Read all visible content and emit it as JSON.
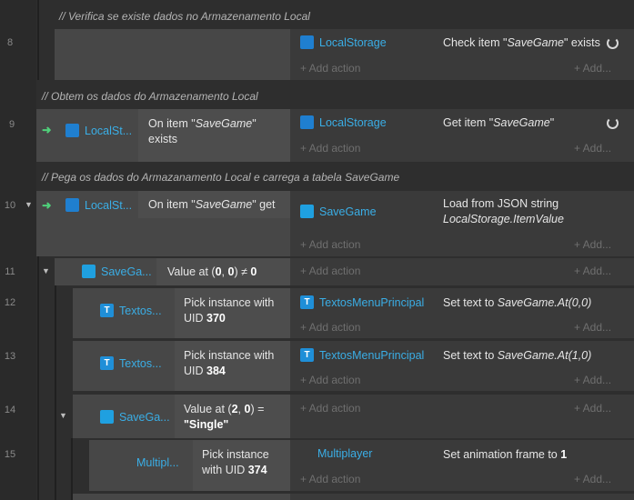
{
  "comments": {
    "c8": "//  Verifica se existe dados no Armazenamento Local",
    "c9": "//  Obtem os dados do Armazenamento Local",
    "c10": "//  Pega os dados do Armazanamento Local e carrega a tabela SaveGame"
  },
  "common": {
    "add_action": "+ Add action",
    "add_short": "+ Add..."
  },
  "rows": {
    "r8": {
      "num": "8",
      "action_obj": "LocalStorage",
      "action_pre": "Check item \"",
      "action_em": "SaveGame",
      "action_post": "\" exists"
    },
    "r9": {
      "num": "9",
      "cond_obj": "LocalSt...",
      "cond_pre": "On item \"",
      "cond_em": "SaveGame",
      "cond_post": "\"",
      "cond_line2": "exists",
      "action_obj": "LocalStorage",
      "action_pre": "Get item \"",
      "action_em": "SaveGame",
      "action_post": "\""
    },
    "r10": {
      "num": "10",
      "cond_obj": "LocalSt...",
      "cond_pre": "On item \"",
      "cond_em": "SaveGame",
      "cond_post": "\" get",
      "action_obj": "SaveGame",
      "action_line1": "Load from JSON string",
      "action_line2": "LocalStorage.ItemValue"
    },
    "r11": {
      "num": "11",
      "cond_obj": "SaveGa...",
      "cond_pre": "Value at (",
      "cond_b1": "0",
      "cond_mid": ", ",
      "cond_b2": "0",
      "cond_post": ") ≠ ",
      "cond_b3": "0"
    },
    "r12": {
      "num": "12",
      "cond_obj": "Textos...",
      "cond_line1": "Pick instance with",
      "cond_line2_pre": "UID ",
      "cond_line2_b": "370",
      "action_obj": "TextosMenuPrincipal",
      "action_pre": "Set text to ",
      "action_em": "SaveGame.At(0,0)"
    },
    "r13": {
      "num": "13",
      "cond_obj": "Textos...",
      "cond_line1": "Pick instance with",
      "cond_line2_pre": "UID ",
      "cond_line2_b": "384",
      "action_obj": "TextosMenuPrincipal",
      "action_pre": "Set text to ",
      "action_em": "SaveGame.At(1,0)"
    },
    "r14": {
      "num": "14",
      "cond_obj": "SaveGa...",
      "cond_pre": "Value at (",
      "cond_b1": "2",
      "cond_mid": ", ",
      "cond_b2": "0",
      "cond_post": ") =",
      "cond_line2_b": "\"Single\""
    },
    "r15": {
      "num": "15",
      "cond_obj": "Multipl...",
      "cond_line1": "Pick instance",
      "cond_line2_pre": "with UID ",
      "cond_line2_b": "374",
      "action_obj": "Multiplayer",
      "action_pre": "Set animation frame to ",
      "action_b": "1"
    }
  },
  "icons": {
    "storage": "lock-storage-icon",
    "array": "array-grid-icon",
    "text": "text-T-icon",
    "trigger": "trigger-arrow-icon",
    "loop": "refresh-icon"
  },
  "colors": {
    "accent": "#3aaee6",
    "trigger": "#4fd07a",
    "storage": "#3aaee6",
    "array": "#1fa0e0"
  }
}
